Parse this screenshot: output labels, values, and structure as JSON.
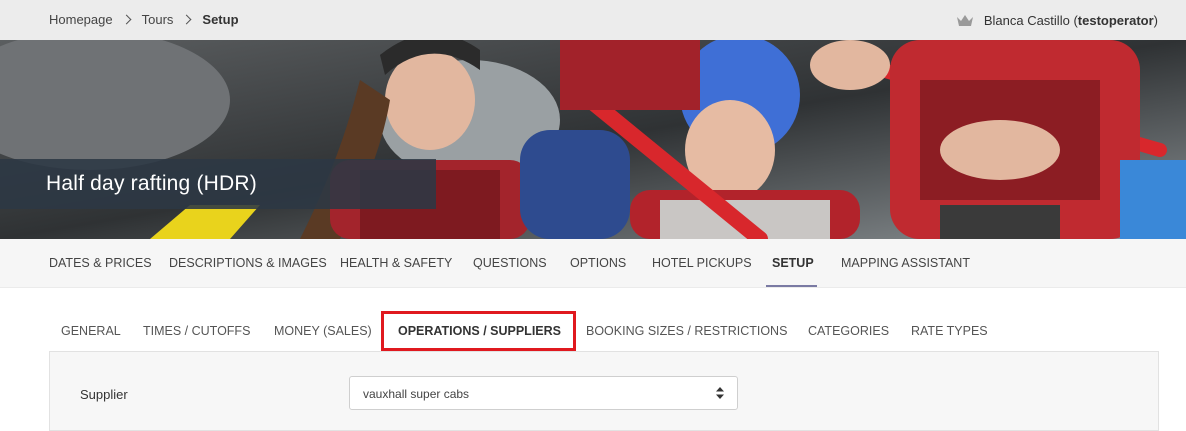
{
  "breadcrumb": {
    "items": [
      "Homepage",
      "Tours",
      "Setup"
    ]
  },
  "user": {
    "name": "Blanca Castillo",
    "username_open": "(",
    "username": "testoperator",
    "username_close": ")",
    "icon": "crown-icon"
  },
  "hero": {
    "title": "Half day rafting (HDR)"
  },
  "main_tabs": [
    {
      "label": "DATES & PRICES"
    },
    {
      "label": "DESCRIPTIONS & IMAGES"
    },
    {
      "label": "HEALTH & SAFETY"
    },
    {
      "label": "QUESTIONS"
    },
    {
      "label": "OPTIONS"
    },
    {
      "label": "HOTEL PICKUPS"
    },
    {
      "label": "SETUP",
      "active": true
    },
    {
      "label": "MAPPING ASSISTANT"
    }
  ],
  "sub_tabs": [
    {
      "label": "GENERAL"
    },
    {
      "label": "TIMES / CUTOFFS"
    },
    {
      "label": "MONEY (SALES)"
    },
    {
      "label": "OPERATIONS / SUPPLIERS",
      "active": true
    },
    {
      "label": "BOOKING SIZES / RESTRICTIONS"
    },
    {
      "label": "CATEGORIES"
    },
    {
      "label": "RATE TYPES"
    }
  ],
  "form": {
    "supplier_label": "Supplier",
    "supplier_value": "vauxhall super cabs"
  },
  "colors": {
    "highlight": "#e0191f",
    "active_underline": "#7a7aa3"
  }
}
